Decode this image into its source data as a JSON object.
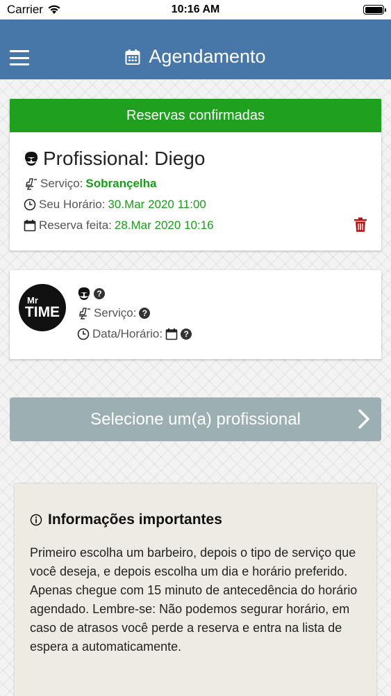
{
  "status_bar": {
    "carrier": "Carrier",
    "time": "10:16 AM"
  },
  "header": {
    "title": "Agendamento",
    "color": "#4777a9"
  },
  "reservations": {
    "header": "Reservas confirmadas",
    "header_color": "#1fa01f",
    "professional": "Profissional: Diego",
    "service_label": "Serviço:",
    "service_value": "Sobrançelha",
    "time_label": "Seu Horário:",
    "time_value": "30.Mar 2020 11:00",
    "booked_label": "Reserva feita:",
    "booked_value": "28.Mar 2020 10:16"
  },
  "selection": {
    "logo_top": "Mr",
    "logo_main": "TIME",
    "unknown_mark": "?",
    "service_label": "Serviço:",
    "datetime_label": "Data/Horário:"
  },
  "cta": {
    "label": "Selecione um(a) profissional"
  },
  "info": {
    "title": "Informações importantes",
    "text": "Primeiro escolha um barbeiro, depois o tipo de serviço que você deseja, e depois escolha um dia e horário preferido. Apenas chegue com 15 minuto de antecedência do horário agendado. Lembre-se: Não podemos segurar horário, em caso de atrasos você perde a reserva e entra na lista de espera a automaticamente."
  },
  "icons": {
    "menu": "hamburger-menu-icon",
    "calendar": "calendar-icon",
    "barber": "barber-face-icon",
    "chair": "barber-chair-icon",
    "clock": "clock-icon",
    "trash": "trash-icon",
    "help": "question-circle-icon",
    "chevron": "chevron-right-icon",
    "info": "info-circle-icon"
  }
}
